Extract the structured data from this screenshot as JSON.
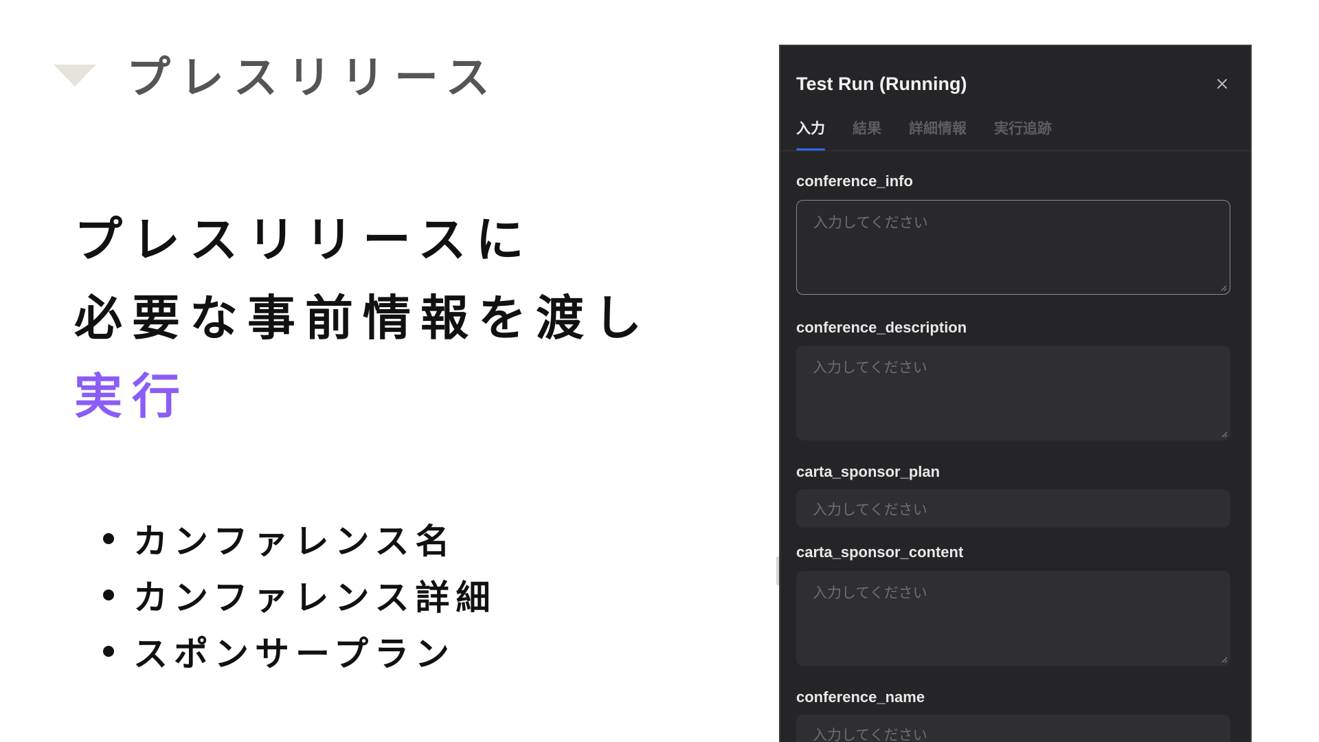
{
  "section": {
    "title": "プレスリリース"
  },
  "headline": {
    "line1": "プレスリリースに",
    "line2": "必要な事前情報を渡し",
    "line3": "実行"
  },
  "bullets": [
    "カンファレンス名",
    "カンファレンス詳細",
    "スポンサープラン"
  ],
  "panel": {
    "title": "Test Run (Running)",
    "close_icon": "close-icon",
    "tabs": [
      {
        "label": "入力",
        "active": true
      },
      {
        "label": "結果",
        "active": false
      },
      {
        "label": "詳細情報",
        "active": false
      },
      {
        "label": "実行追跡",
        "active": false
      }
    ],
    "fields": [
      {
        "label": "conference_info",
        "placeholder": "入力してください",
        "multiline": true,
        "focused": true
      },
      {
        "label": "conference_description",
        "placeholder": "入力してください",
        "multiline": true,
        "focused": false
      },
      {
        "label": "carta_sponsor_plan",
        "placeholder": "入力してください",
        "multiline": false,
        "focused": false
      },
      {
        "label": "carta_sponsor_content",
        "placeholder": "入力してください",
        "multiline": true,
        "focused": false
      },
      {
        "label": "conference_name",
        "placeholder": "入力してください",
        "multiline": false,
        "focused": false
      }
    ]
  },
  "colors": {
    "accent_purple": "#8b5cf6",
    "tab_indicator": "#2f6bff",
    "panel_bg": "#252527",
    "input_bg": "#2f2f32"
  }
}
